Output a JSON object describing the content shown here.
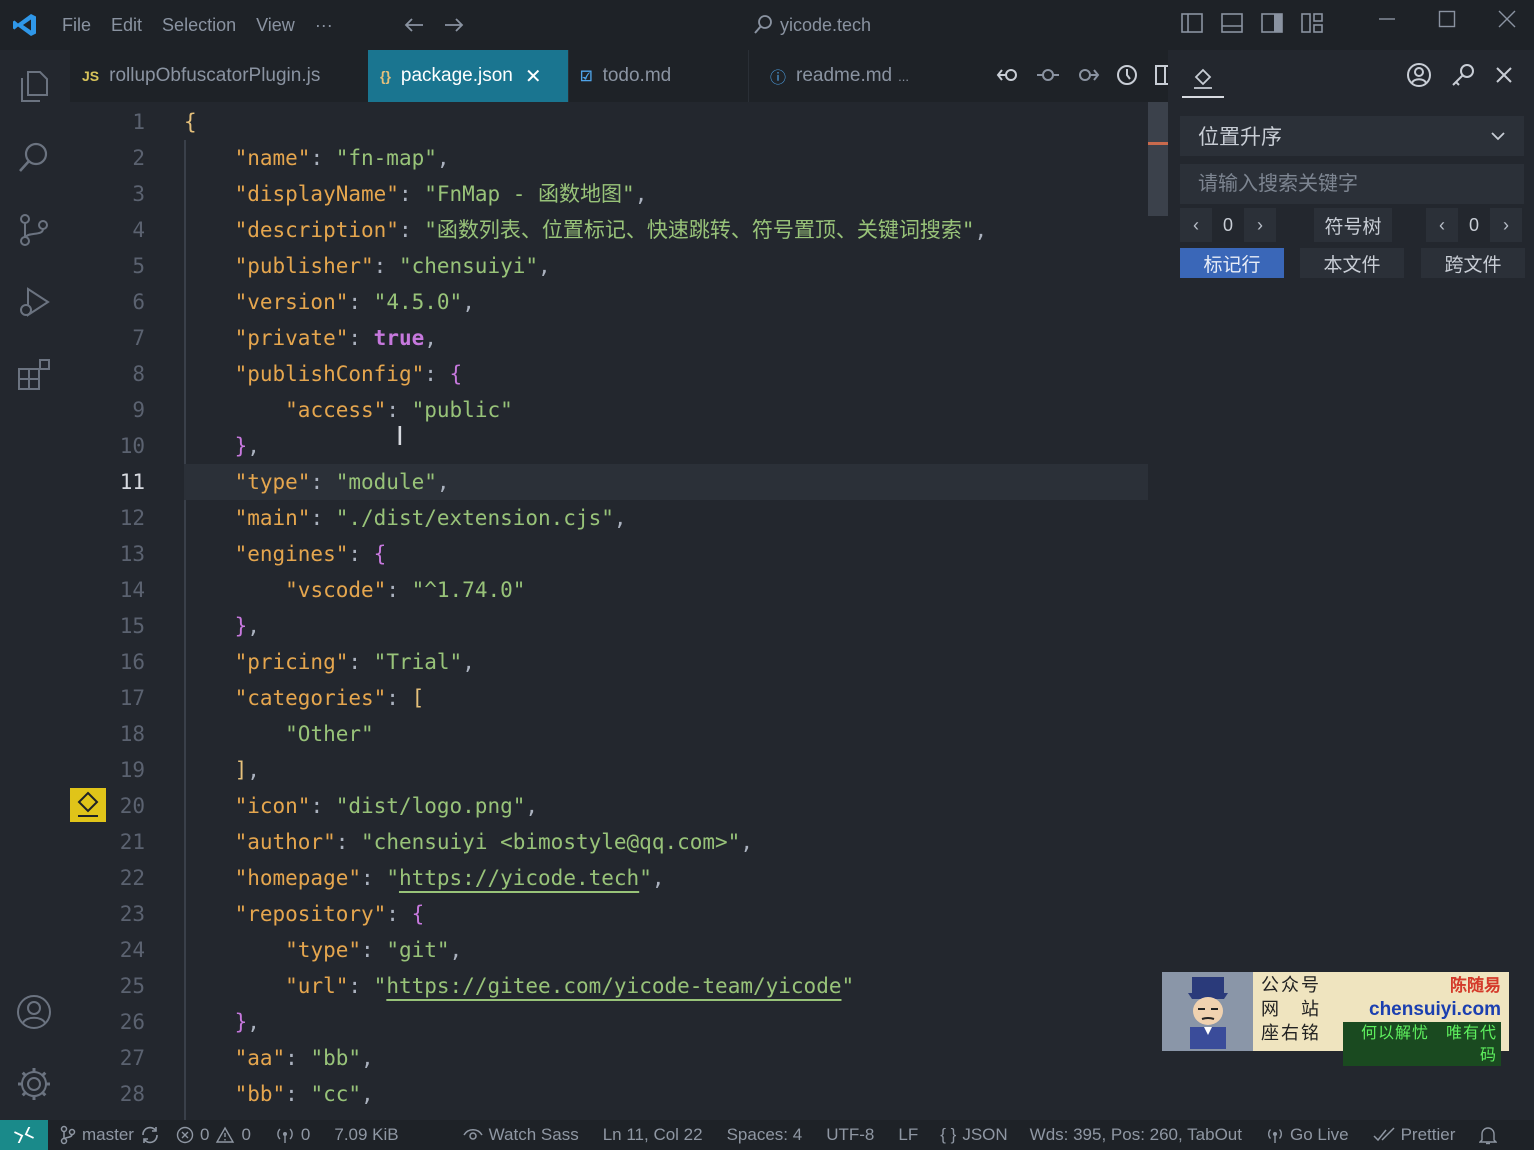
{
  "titlebar": {
    "menu": [
      "File",
      "Edit",
      "Selection",
      "View",
      "···"
    ],
    "command_center": "yicode.tech"
  },
  "tabs": [
    {
      "icon": "JS",
      "label": "rollupObfuscatorPlugin.js",
      "active": false
    },
    {
      "icon": "{}",
      "label": "package.json",
      "active": true,
      "close": "✕"
    },
    {
      "icon": "☑",
      "label": "todo.md",
      "active": false
    },
    {
      "icon": "ⓘ",
      "label": "readme.md",
      "active": false,
      "truncation": "..."
    }
  ],
  "editor": {
    "current_line": 11,
    "line_numbers": [
      "1",
      "2",
      "3",
      "4",
      "5",
      "6",
      "7",
      "8",
      "9",
      "10",
      "11",
      "12",
      "13",
      "14",
      "15",
      "16",
      "17",
      "18",
      "19",
      "20",
      "21",
      "22",
      "23",
      "24",
      "25",
      "26",
      "27",
      "28"
    ],
    "bookmark_line": 20,
    "lines": [
      [
        [
          "br1",
          "{"
        ]
      ],
      [
        [
          "p",
          "    "
        ],
        [
          "k",
          "\"name\""
        ],
        [
          "p",
          ": "
        ],
        [
          "s",
          "\"fn-map\""
        ],
        [
          "p",
          ","
        ]
      ],
      [
        [
          "p",
          "    "
        ],
        [
          "k",
          "\"displayName\""
        ],
        [
          "p",
          ": "
        ],
        [
          "s",
          "\"FnMap - 函数地图\""
        ],
        [
          "p",
          ","
        ]
      ],
      [
        [
          "p",
          "    "
        ],
        [
          "k",
          "\"description\""
        ],
        [
          "p",
          ": "
        ],
        [
          "s",
          "\"函数列表、位置标记、快速跳转、符号置顶、关键词搜索\""
        ],
        [
          "p",
          ","
        ]
      ],
      [
        [
          "p",
          "    "
        ],
        [
          "k",
          "\"publisher\""
        ],
        [
          "p",
          ": "
        ],
        [
          "s",
          "\"chensuiyi\""
        ],
        [
          "p",
          ","
        ]
      ],
      [
        [
          "p",
          "    "
        ],
        [
          "k",
          "\"version\""
        ],
        [
          "p",
          ": "
        ],
        [
          "s",
          "\"4.5.0\""
        ],
        [
          "p",
          ","
        ]
      ],
      [
        [
          "p",
          "    "
        ],
        [
          "k",
          "\"private\""
        ],
        [
          "p",
          ": "
        ],
        [
          "b",
          "true"
        ],
        [
          "p",
          ","
        ]
      ],
      [
        [
          "p",
          "    "
        ],
        [
          "k",
          "\"publishConfig\""
        ],
        [
          "p",
          ": "
        ],
        [
          "br2",
          "{"
        ]
      ],
      [
        [
          "p",
          "        "
        ],
        [
          "k",
          "\"access\""
        ],
        [
          "p",
          ": "
        ],
        [
          "s",
          "\"public\""
        ]
      ],
      [
        [
          "p",
          "    "
        ],
        [
          "br2",
          "}"
        ],
        [
          "p",
          ","
        ]
      ],
      [
        [
          "p",
          "    "
        ],
        [
          "k",
          "\"type\""
        ],
        [
          "p",
          ": "
        ],
        [
          "s",
          "\"module\""
        ],
        [
          "p",
          ","
        ]
      ],
      [
        [
          "p",
          "    "
        ],
        [
          "k",
          "\"main\""
        ],
        [
          "p",
          ": "
        ],
        [
          "s",
          "\"./dist/extension.cjs\""
        ],
        [
          "p",
          ","
        ]
      ],
      [
        [
          "p",
          "    "
        ],
        [
          "k",
          "\"engines\""
        ],
        [
          "p",
          ": "
        ],
        [
          "br2",
          "{"
        ]
      ],
      [
        [
          "p",
          "        "
        ],
        [
          "k",
          "\"vscode\""
        ],
        [
          "p",
          ": "
        ],
        [
          "s",
          "\"^1.74.0\""
        ]
      ],
      [
        [
          "p",
          "    "
        ],
        [
          "br2",
          "}"
        ],
        [
          "p",
          ","
        ]
      ],
      [
        [
          "p",
          "    "
        ],
        [
          "k",
          "\"pricing\""
        ],
        [
          "p",
          ": "
        ],
        [
          "s",
          "\"Trial\""
        ],
        [
          "p",
          ","
        ]
      ],
      [
        [
          "p",
          "    "
        ],
        [
          "k",
          "\"categories\""
        ],
        [
          "p",
          ": "
        ],
        [
          "br1",
          "["
        ]
      ],
      [
        [
          "p",
          "        "
        ],
        [
          "s",
          "\"Other\""
        ]
      ],
      [
        [
          "p",
          "    "
        ],
        [
          "br1",
          "]"
        ],
        [
          "p",
          ","
        ]
      ],
      [
        [
          "p",
          "    "
        ],
        [
          "k",
          "\"icon\""
        ],
        [
          "p",
          ": "
        ],
        [
          "s",
          "\"dist/logo.png\""
        ],
        [
          "p",
          ","
        ]
      ],
      [
        [
          "p",
          "    "
        ],
        [
          "k",
          "\"author\""
        ],
        [
          "p",
          ": "
        ],
        [
          "s",
          "\"chensuiyi <bimostyle@qq.com>\""
        ],
        [
          "p",
          ","
        ]
      ],
      [
        [
          "p",
          "    "
        ],
        [
          "k",
          "\"homepage\""
        ],
        [
          "p",
          ": "
        ],
        [
          "s",
          "\""
        ],
        [
          "s url",
          "https://yicode.tech"
        ],
        [
          "s",
          "\""
        ],
        [
          "p",
          ","
        ]
      ],
      [
        [
          "p",
          "    "
        ],
        [
          "k",
          "\"repository\""
        ],
        [
          "p",
          ": "
        ],
        [
          "br2",
          "{"
        ]
      ],
      [
        [
          "p",
          "        "
        ],
        [
          "k",
          "\"type\""
        ],
        [
          "p",
          ": "
        ],
        [
          "s",
          "\"git\""
        ],
        [
          "p",
          ","
        ]
      ],
      [
        [
          "p",
          "        "
        ],
        [
          "k",
          "\"url\""
        ],
        [
          "p",
          ": "
        ],
        [
          "s",
          "\""
        ],
        [
          "s url",
          "https://gitee.com/yicode-team/yicode"
        ],
        [
          "s",
          "\""
        ]
      ],
      [
        [
          "p",
          "    "
        ],
        [
          "br2",
          "}"
        ],
        [
          "p",
          ","
        ]
      ],
      [
        [
          "p",
          "    "
        ],
        [
          "k",
          "\"aa\""
        ],
        [
          "p",
          ": "
        ],
        [
          "s",
          "\"bb\""
        ],
        [
          "p",
          ","
        ]
      ],
      [
        [
          "p",
          "    "
        ],
        [
          "k",
          "\"bb\""
        ],
        [
          "p",
          ": "
        ],
        [
          "s",
          "\"cc\""
        ],
        [
          "p",
          ","
        ]
      ]
    ]
  },
  "sidepanel": {
    "sort_select": "位置升序",
    "search_placeholder": "请输入搜索关键字",
    "left_stepper": {
      "prev": "‹",
      "value": "0",
      "next": "›"
    },
    "tree_button": "符号树",
    "right_stepper": {
      "prev": "‹",
      "value": "0",
      "next": "›"
    },
    "mode_buttons": [
      {
        "label": "标记行",
        "active": true
      },
      {
        "label": "本文件",
        "active": false
      },
      {
        "label": "跨文件",
        "active": false
      }
    ]
  },
  "banner": {
    "left": [
      "公众号",
      "网　站",
      "座右铭"
    ],
    "name": "陈随易",
    "site": "chensuiyi.com",
    "motto": "何以解忧　唯有代码"
  },
  "statusbar": {
    "branch": "master",
    "errors": "0",
    "warnings": "0",
    "ports": "0",
    "file_size": "7.09 KiB",
    "watch_sass": "Watch Sass",
    "position": "Ln 11, Col 22",
    "spaces": "Spaces: 4",
    "encoding": "UTF-8",
    "eol": "LF",
    "language": "JSON",
    "word_count": "Wds: 395, Pos: 260, TabOut",
    "go_live": "Go Live",
    "prettier": "Prettier"
  },
  "colors": {
    "accent_tab": "#1a7590",
    "string": "#98c379",
    "key": "#e5a64e",
    "keyword": "#c678dd",
    "remote": "#1a8a8a",
    "bookmark": "#e0c419",
    "mode_active": "#3a67b8"
  }
}
